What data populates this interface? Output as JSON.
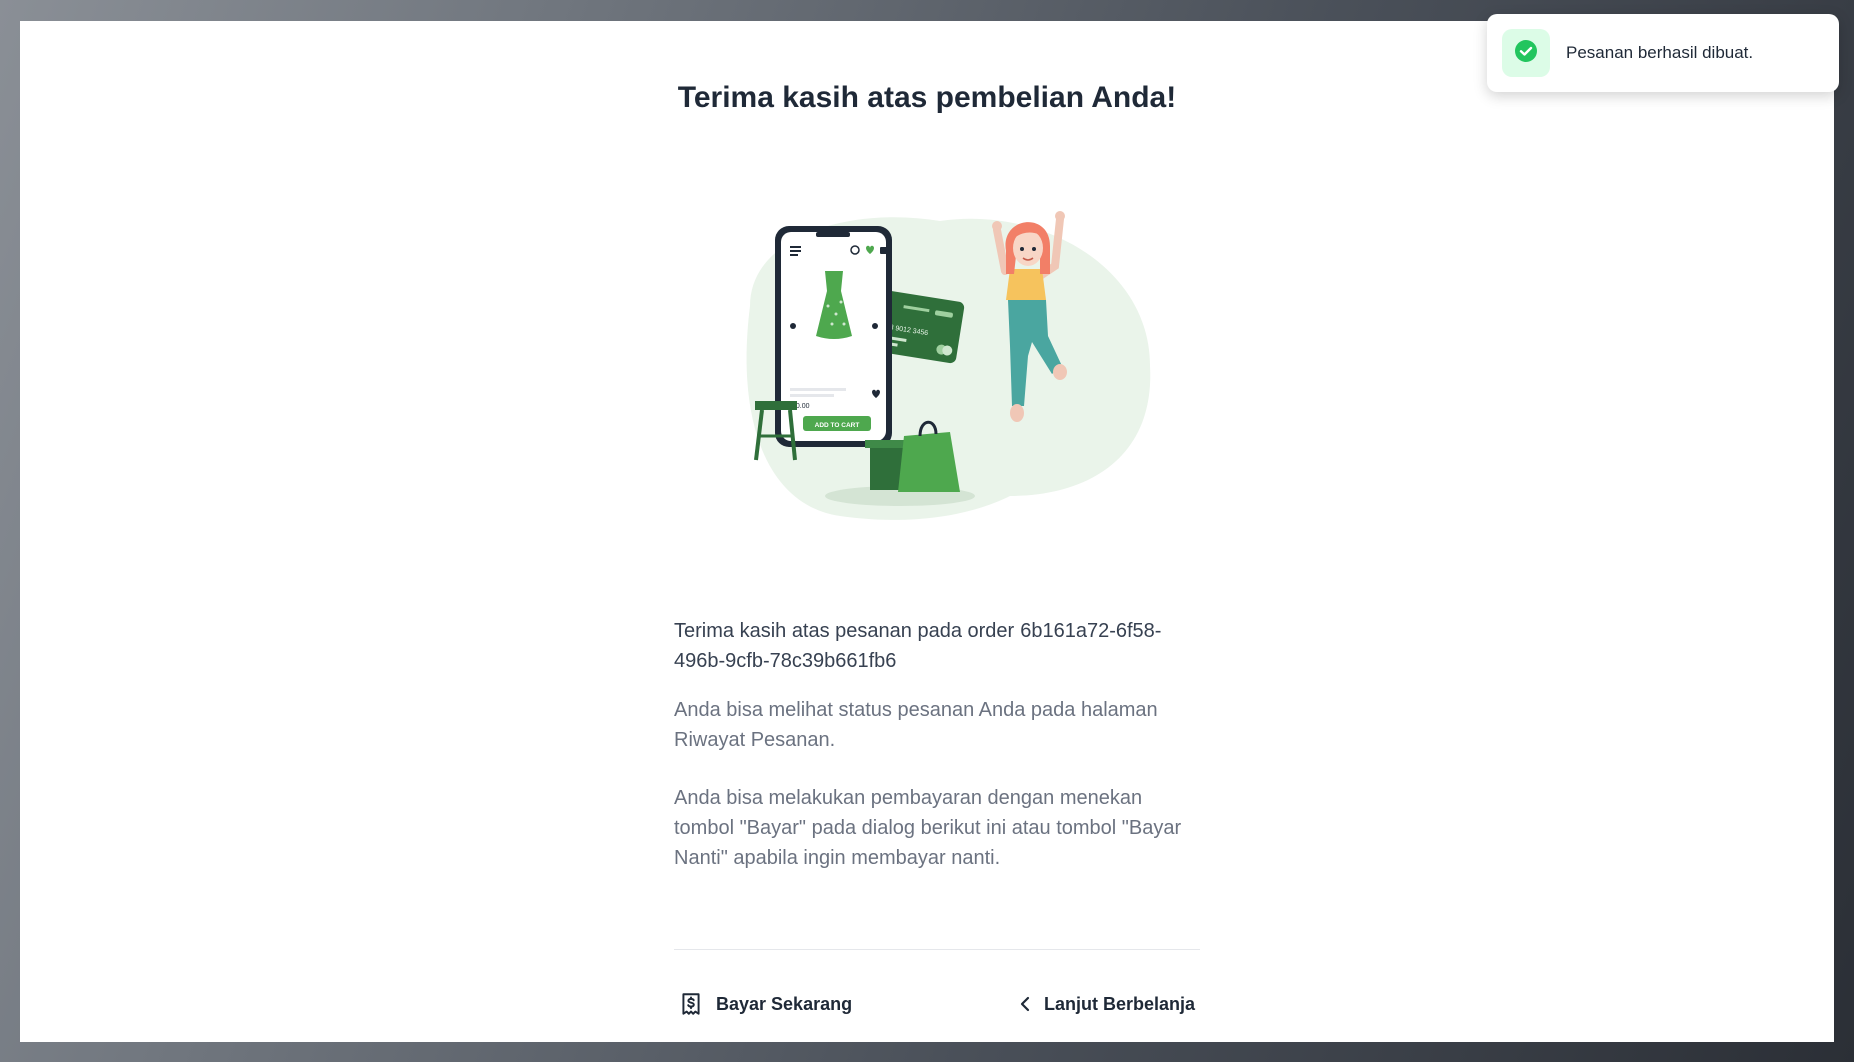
{
  "page": {
    "title": "Terima kasih atas pembelian Anda!",
    "order_prefix": "Terima kasih atas pesanan pada order",
    "order_id": "6b161a72-6f58-496b-9cfb-78c39b661fb6",
    "status_info": "Anda bisa melihat status pesanan Anda pada halaman Riwayat Pesanan.",
    "payment_info": "Anda bisa melakukan pembayaran dengan menekan tombol \"Bayar\" pada dialog berikut ini atau tombol \"Bayar Nanti\" apabila ingin membayar nanti."
  },
  "actions": {
    "pay_now": "Bayar Sekarang",
    "pay_now_icon": "receipt-dollar-icon",
    "continue_shopping": "Lanjut Berbelanja",
    "continue_icon": "chevron-left-icon"
  },
  "toast": {
    "message": "Pesanan berhasil dibuat.",
    "icon": "check-circle-icon"
  },
  "illustration": {
    "phone_button": "ADD TO CART",
    "phone_price": "20.00",
    "card_number": "34 5678 9012 3456"
  },
  "colors": {
    "accent_green": "#4ea84e",
    "dark_green": "#2f6f3a",
    "success_bg": "#dcfce7",
    "text_dark": "#1f2937",
    "text_muted": "#6b7280"
  }
}
